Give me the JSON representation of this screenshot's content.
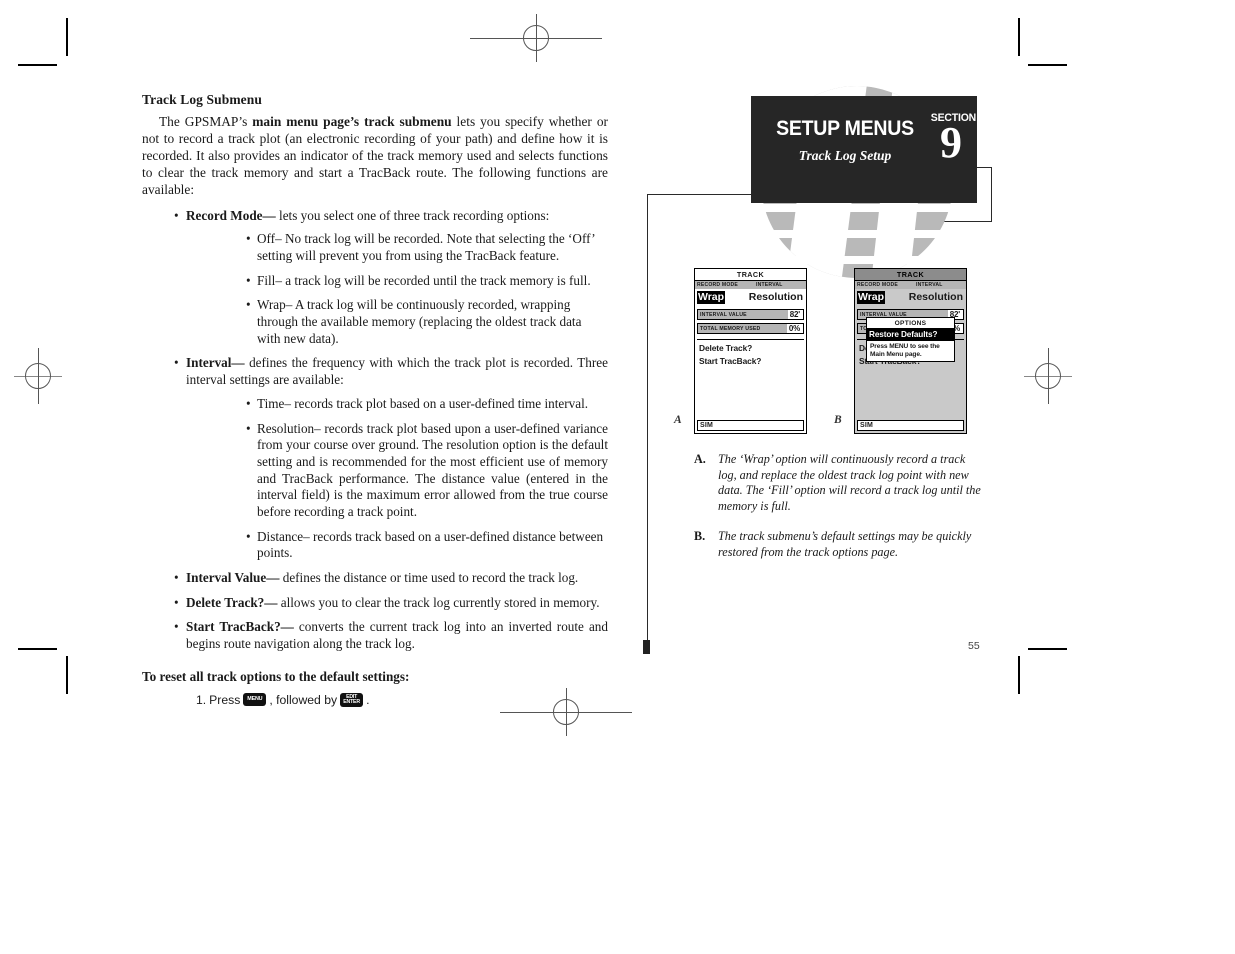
{
  "document": {
    "page_number": "55",
    "section_badge": {
      "title": "SETUP MENUS",
      "subtitle": "Track Log Setup",
      "section_word": "SECTION",
      "section_number": "9"
    }
  },
  "article": {
    "heading": "Track Log Submenu",
    "intro_lead": "The GPSMAP’s ",
    "intro_bold": "main menu page’s track submenu",
    "intro_rest": " lets you specify whether or not to record a track plot (an electronic recording of your path) and define how it is recorded. It also provides an indicator of the track memory used and selects functions to clear the track memory and start a TracBack route. The following functions are available:",
    "bullets": [
      {
        "term": "Record Mode—",
        "text": " lets you select one of three track recording options:",
        "sub": [
          "Off– No track log will be recorded. Note that selecting the ‘Off’ setting will prevent you from using the TracBack feature.",
          "Fill– a track log will be recorded until the track memory is full.",
          "Wrap– A track log will be continuously recorded, wrapping through the available memory (replacing the oldest track data with new data)."
        ]
      },
      {
        "term": "Interval—",
        "text": " defines the frequency with which the track plot is recorded. Three interval settings are available:",
        "sub": [
          "Time– records track plot based on a user-defined time interval.",
          "Resolution– records track plot based upon a user-defined variance from your course over ground. The resolution option is the default setting and is recommended for the most efficient use of memory and TracBack performance. The distance value (entered in the interval field) is the maximum error allowed from the true course before recording a track point.",
          "Distance– records track based on a user-defined distance between points."
        ]
      },
      {
        "term": "Interval Value—",
        "text": " defines the distance or time used to record the track log.",
        "sub": []
      },
      {
        "term": "Delete Track?—",
        "text": " allows you to clear the track log currently stored in memory.",
        "sub": []
      },
      {
        "term": "Start TracBack?—",
        "text": " converts the current track log into an inverted route and begins route navigation along the track log.",
        "sub": []
      }
    ],
    "procedure": {
      "heading": "To reset all track options to the default settings:",
      "step_number": "1.",
      "step_pre": "Press",
      "step_mid": ", followed by",
      "step_post": ".",
      "key_menu": "MENU",
      "key_enter_top": "EDIT",
      "key_enter_bottom": "ENTER"
    }
  },
  "figures": {
    "a": {
      "letter": "A",
      "screen": {
        "title": "TRACK",
        "label_left": "RECORD MODE",
        "label_right": "INTERVAL",
        "value_left": "Wrap",
        "value_right": "Resolution",
        "field1_label": "INTERVAL VALUE",
        "field1_value": "82'",
        "field2_label": "TOTAL MEMORY USED",
        "field2_value": "0%",
        "menu_item_1": "Delete Track?",
        "menu_item_2": "Start TracBack?",
        "status": "SIM"
      }
    },
    "b": {
      "letter": "B",
      "screen": {
        "title": "TRACK",
        "label_left": "RECORD MODE",
        "label_right": "INTERVAL",
        "value_left": "Wrap",
        "value_right": "Resolution",
        "field1_label": "INTERVAL VALUE",
        "field1_value": "82'",
        "field2_label": "TOTAL MEMORY USED",
        "field2_value": "0%",
        "menu_item_1": "Delete Track?",
        "menu_item_2": "Start TracBack?",
        "status": "SIM",
        "popup": {
          "title": "OPTIONS",
          "highlight": "Restore Defaults?",
          "note": "Press MENU to see the Main Menu page."
        }
      }
    },
    "captions": [
      {
        "mark": "A.",
        "text": "The ‘Wrap’ option will continuously record a track log, and replace the oldest track log point with new data. The ‘Fill’ option will record a track log until the memory is full."
      },
      {
        "mark": "B.",
        "text": "The track submenu’s default settings may be quickly restored from the track options page."
      }
    ]
  },
  "colors": {
    "badge_bg": "#262626",
    "globe_watermark": "#b9b9b9",
    "lcd_label_bg": "#b5b5b5",
    "lcd_gray_bg": "#c9c9c9"
  }
}
